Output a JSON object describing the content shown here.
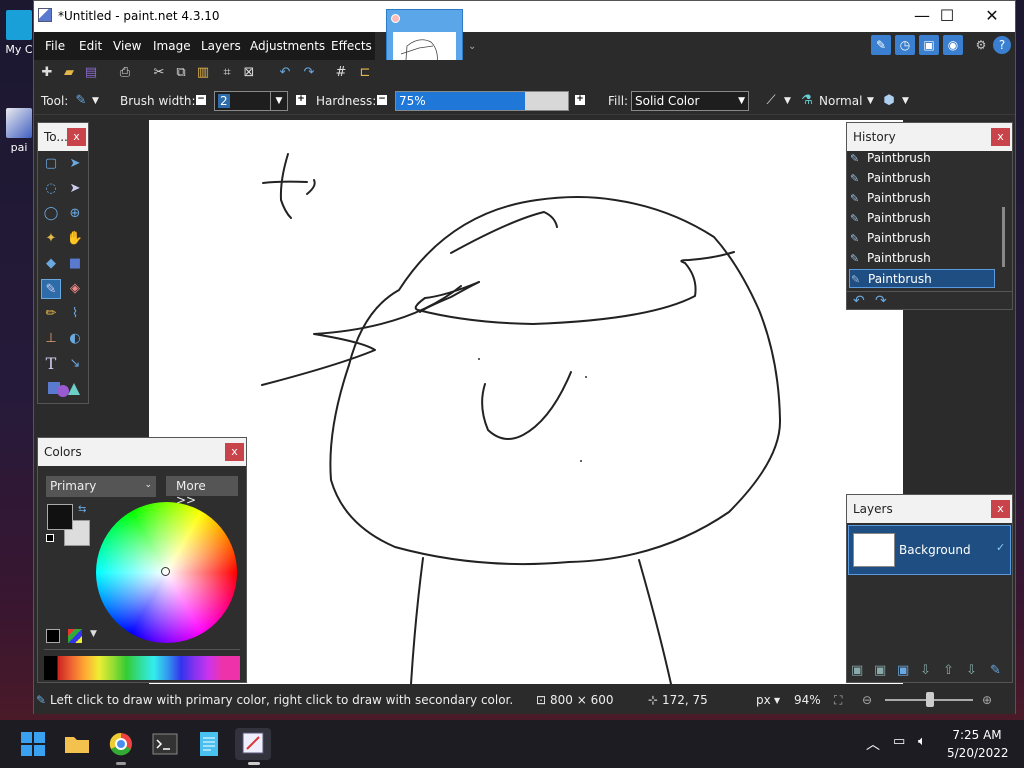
{
  "desktop": {
    "icons": [
      {
        "label": "My C"
      },
      {
        "label": "pai"
      }
    ]
  },
  "window": {
    "title": "*Untitled - paint.net 4.3.10",
    "minimize": "—",
    "maximize": "☐",
    "close": "✕"
  },
  "menu": {
    "items": [
      "File",
      "Edit",
      "View",
      "Image",
      "Layers",
      "Adjustments",
      "Effects"
    ]
  },
  "toolbar": {
    "tool_label": "Tool:",
    "brush_width_label": "Brush width:",
    "brush_width_value": "2",
    "hardness_label": "Hardness:",
    "hardness_value": "75%",
    "hardness_fraction": 0.75,
    "fill_label": "Fill:",
    "fill_value": "Solid Color",
    "blend_mode": "Normal"
  },
  "tools_panel": {
    "title": "To...",
    "close": "x"
  },
  "history_panel": {
    "title": "History",
    "close": "x",
    "items": [
      "Paintbrush",
      "Paintbrush",
      "Paintbrush",
      "Paintbrush",
      "Paintbrush",
      "Paintbrush",
      "Paintbrush"
    ],
    "selected_index": 6
  },
  "colors_panel": {
    "title": "Colors",
    "close": "x",
    "selector": "Primary",
    "more_button": "More >>",
    "primary_color": "#111111",
    "secondary_color": "#dddddd"
  },
  "layers_panel": {
    "title": "Layers",
    "close": "x",
    "layer_name": "Background"
  },
  "status": {
    "hint": "Left click to draw with primary color, right click to draw with secondary color.",
    "image_size": "800 × 600",
    "cursor_pos": "172, 75",
    "units": "px",
    "zoom": "94%"
  },
  "taskbar": {
    "time": "7:25 AM",
    "date": "5/20/2022"
  },
  "colors": {
    "accent": "#2d6ca8",
    "panel_close": "#c8434a",
    "history_selected": "#1f4f82"
  }
}
